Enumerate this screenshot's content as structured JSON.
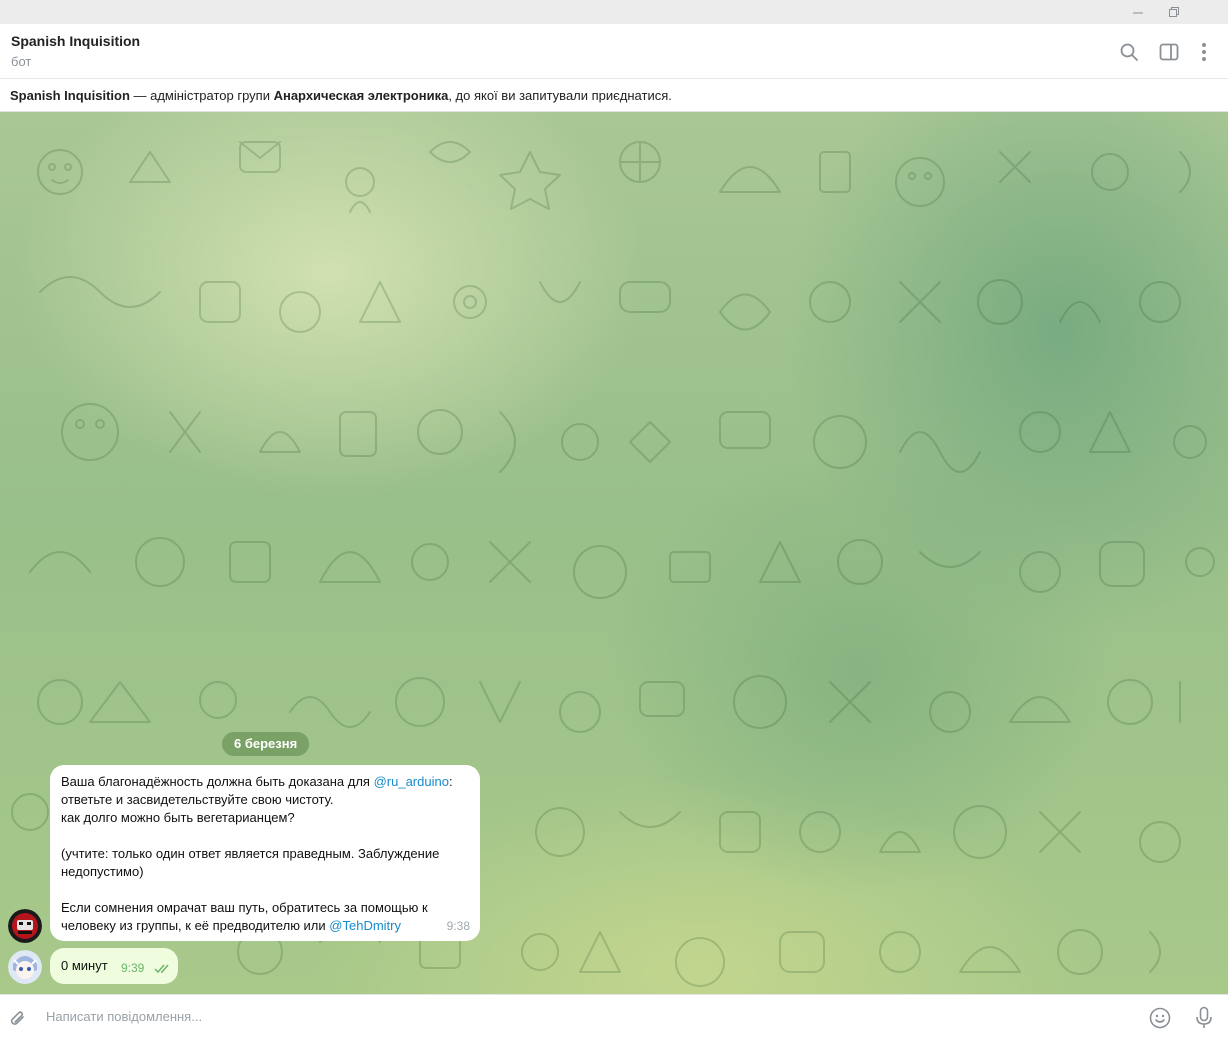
{
  "window": {
    "minimize_icon": "minimize-icon",
    "restore_icon": "restore-icon"
  },
  "header": {
    "title": "Spanish Inquisition",
    "subtitle": "бот",
    "icons": [
      "search-icon",
      "sidebar-toggle-icon",
      "more-vertical-icon"
    ]
  },
  "banner": {
    "bot_name": "Spanish Inquisition",
    "text_1": " — адміністратор групи ",
    "group_name": "Анархическая электроника",
    "text_2": ", до якої ви запитували приєднатися."
  },
  "chat": {
    "date_separator": "6 березня",
    "messages": [
      {
        "direction": "incoming",
        "line_1_prefix": "Ваша благонадёжность должна быть доказана для ",
        "line_1_link": "@ru_arduino",
        "line_1_suffix": ":",
        "line_2": "ответьте и засвидетельствуйте свою чистоту.",
        "line_3": "как долго можно быть вегетарианцем?",
        "line_5": "(учтите: только один ответ является праведным. Заблуждение",
        "line_6": "недопустимо)",
        "line_8": "Если сомнения омрачат ваш путь, обратитесь за помощью к",
        "line_9_prefix": "человеку из группы, к её предводителю или ",
        "line_9_link": "@TehDmitry",
        "time": "9:38"
      },
      {
        "direction": "outgoing",
        "text": "0 минут",
        "time": "9:39",
        "status": "read"
      }
    ]
  },
  "composer": {
    "placeholder": "Написати повідомлення...",
    "icons": [
      "attach-icon",
      "emoji-icon",
      "microphone-icon"
    ]
  },
  "colors": {
    "accent_link": "#168acd",
    "outgoing_bubble": "#effdde",
    "read_check": "#6cb36b",
    "date_pill": "#6e965a"
  }
}
